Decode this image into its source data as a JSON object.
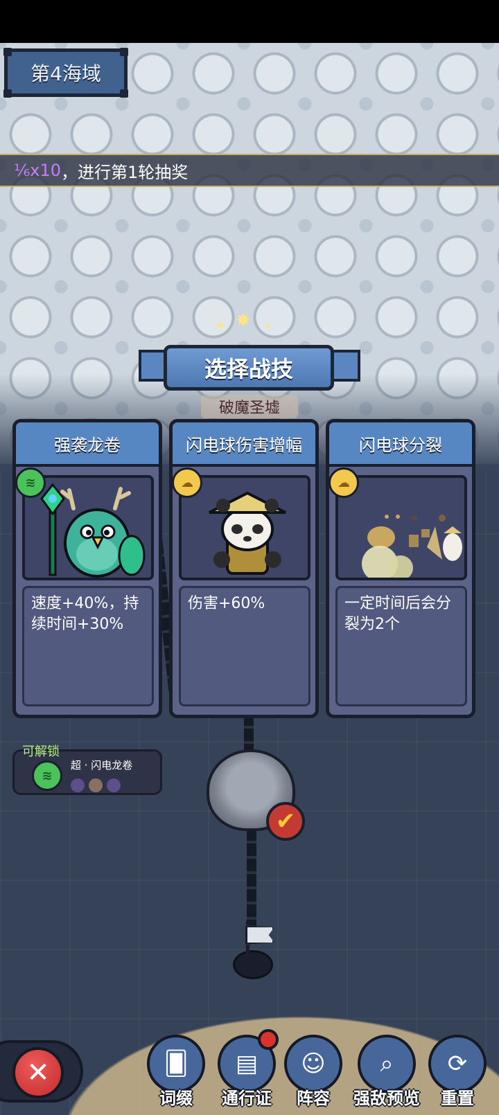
{
  "region": {
    "title": "第4海域"
  },
  "announcement": {
    "item": "⅙x10",
    "message": "，进行第1轮抽奖"
  },
  "dialog": {
    "title": "选择战技",
    "location": "破魔圣墟"
  },
  "cards": [
    {
      "title": "强袭龙卷",
      "badge_icon": "green-wind-icon",
      "description": "速度+40%，持续时间+30%"
    },
    {
      "title": "闪电球伤害增幅",
      "badge_icon": "gold-cloud-icon",
      "description": "伤害+60%"
    },
    {
      "title": "闪电球分裂",
      "badge_icon": "gold-cloud-icon",
      "description": "一定时间后会分裂为2个"
    }
  ],
  "unlock": {
    "label": "可解锁",
    "name": "超 · 闪电龙卷",
    "dot_colors": [
      "#5d4f8c",
      "#8a6f63",
      "#5d4f8c"
    ]
  },
  "bottom_nav": [
    {
      "label": "词缀",
      "icon": "card-icon"
    },
    {
      "label": "通行证",
      "icon": "pass-book-icon",
      "notification": true
    },
    {
      "label": "阵容",
      "icon": "hero-avatar-icon"
    },
    {
      "label": "强敌预览",
      "icon": "magnifier-icon"
    },
    {
      "label": "重置",
      "icon": "refresh-icon"
    }
  ],
  "colors": {
    "header_blue": "#5787c2",
    "card_body": "#5c6388",
    "unlock_green": "#b6f07a",
    "close_red": "#c22b2b"
  }
}
